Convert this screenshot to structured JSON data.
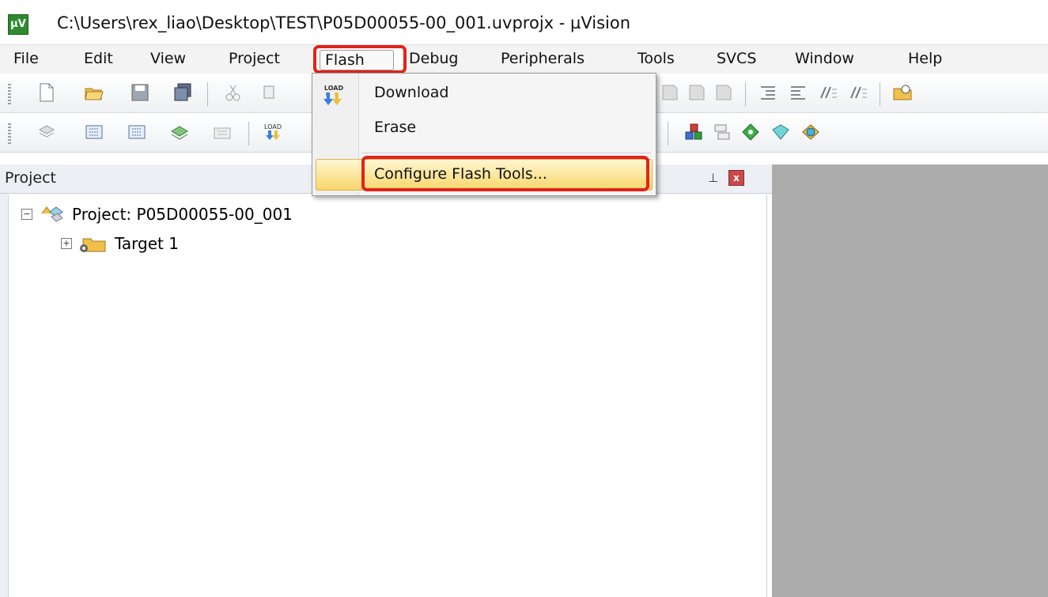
{
  "window": {
    "title": "C:\\Users\\rex_liao\\Desktop\\TEST\\P05D00055-00_001.uvprojx - µVision",
    "app_icon": "µV"
  },
  "menubar": {
    "items": [
      "File",
      "Edit",
      "View",
      "Project",
      "Flash",
      "Debug",
      "Peripherals",
      "Tools",
      "SVCS",
      "Window",
      "Help"
    ],
    "active": "Flash"
  },
  "flash_menu": {
    "items": [
      {
        "label": "Download",
        "icon": "load-icon"
      },
      {
        "label": "Erase",
        "icon": ""
      },
      {
        "label": "Configure Flash Tools...",
        "icon": "",
        "highlighted": true
      }
    ],
    "load_badge": "LOAD"
  },
  "project_panel": {
    "title": "Project",
    "pin_glyph": "⊥",
    "close_glyph": "x",
    "tree": [
      {
        "label": "Project: P05D00055-00_001",
        "expanded": true,
        "glyph": "−"
      },
      {
        "label": "Target 1",
        "expanded": false,
        "glyph": "+"
      }
    ]
  },
  "toolbar": {
    "load_badge": "LOAD"
  },
  "colors": {
    "highlight_box": "#e2231a",
    "menu_hover": "#f7d66b",
    "editor_area": "#acacac"
  }
}
